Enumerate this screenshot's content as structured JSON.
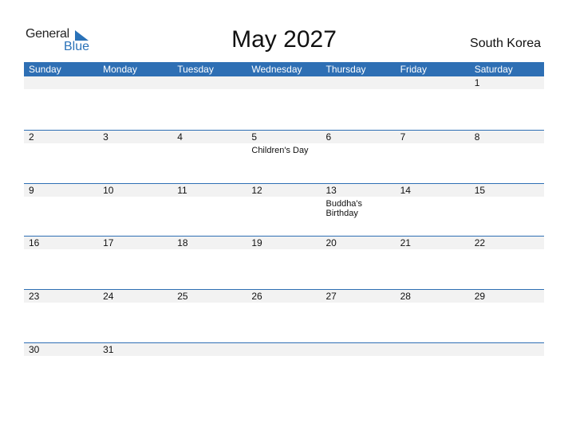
{
  "logo": {
    "general": "General",
    "blue": "Blue"
  },
  "title": "May 2027",
  "country": "South Korea",
  "weekdays": [
    "Sunday",
    "Monday",
    "Tuesday",
    "Wednesday",
    "Thursday",
    "Friday",
    "Saturday"
  ],
  "weeks": [
    {
      "days": [
        "",
        "",
        "",
        "",
        "",
        "",
        "1"
      ],
      "events": [
        "",
        "",
        "",
        "",
        "",
        "",
        ""
      ]
    },
    {
      "days": [
        "2",
        "3",
        "4",
        "5",
        "6",
        "7",
        "8"
      ],
      "events": [
        "",
        "",
        "",
        "Children's Day",
        "",
        "",
        ""
      ]
    },
    {
      "days": [
        "9",
        "10",
        "11",
        "12",
        "13",
        "14",
        "15"
      ],
      "events": [
        "",
        "",
        "",
        "",
        "Buddha's Birthday",
        "",
        ""
      ]
    },
    {
      "days": [
        "16",
        "17",
        "18",
        "19",
        "20",
        "21",
        "22"
      ],
      "events": [
        "",
        "",
        "",
        "",
        "",
        "",
        ""
      ]
    },
    {
      "days": [
        "23",
        "24",
        "25",
        "26",
        "27",
        "28",
        "29"
      ],
      "events": [
        "",
        "",
        "",
        "",
        "",
        "",
        ""
      ]
    },
    {
      "days": [
        "30",
        "31",
        "",
        "",
        "",
        "",
        ""
      ],
      "events": [
        "",
        "",
        "",
        "",
        "",
        "",
        ""
      ]
    }
  ],
  "colors": {
    "accent": "#2e6fb4",
    "daybar": "#f2f2f2"
  }
}
